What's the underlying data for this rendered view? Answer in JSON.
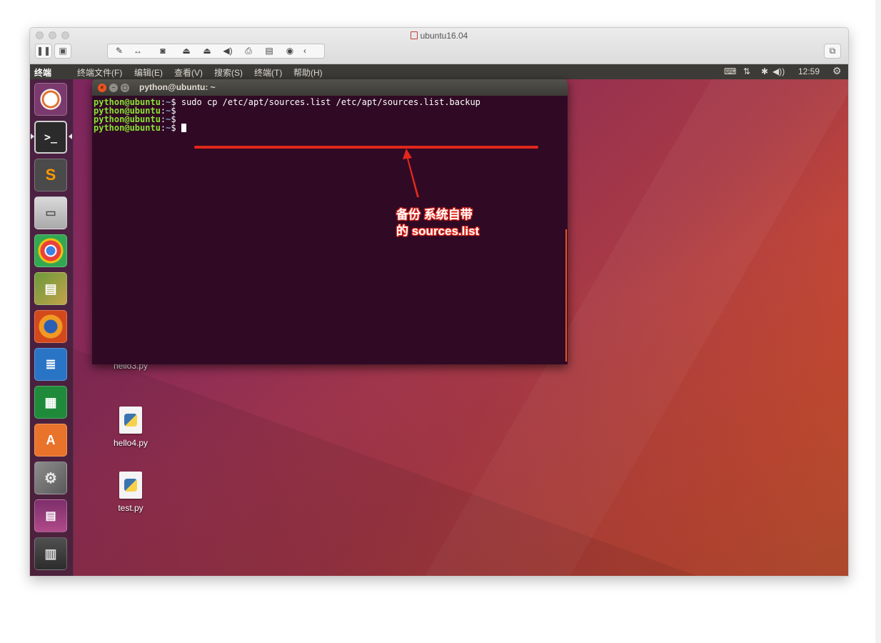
{
  "vm": {
    "title": "ubuntu16.04"
  },
  "top_panel": {
    "app_name": "终端",
    "menus": [
      "终端",
      "文件(F)",
      "编辑(E)",
      "查看(V)",
      "搜索(S)",
      "终端(T)",
      "帮助(H)"
    ],
    "clock": "12:59"
  },
  "terminal": {
    "title": "python@ubuntu: ~",
    "lines": [
      {
        "user": "python@ubuntu",
        "path": "~",
        "symbol": "$",
        "command": "sudo cp /etc/apt/sources.list /etc/apt/sources.list.backup"
      },
      {
        "user": "python@ubuntu",
        "path": "~",
        "symbol": "$",
        "command": ""
      },
      {
        "user": "python@ubuntu",
        "path": "~",
        "symbol": "$",
        "command": ""
      },
      {
        "user": "python@ubuntu",
        "path": "~",
        "symbol": "$",
        "command": ""
      }
    ]
  },
  "annotation": {
    "line1": "备份 系统自带",
    "line2": "的 sources.list",
    "color": "#e0281c"
  },
  "desktop": {
    "icons": [
      {
        "label": "hello3.py"
      },
      {
        "label": "hello4.py"
      },
      {
        "label": "test.py"
      }
    ]
  },
  "launcher": {
    "items": [
      "ubuntu-dash-icon",
      "terminal-icon",
      "sublime-text-icon",
      "files-icon",
      "chrome-icon",
      "books-icon",
      "firefox-icon",
      "writer-icon",
      "calc-icon",
      "software-center-icon",
      "system-settings-icon",
      "workspace-icon",
      "trash-icon"
    ]
  }
}
